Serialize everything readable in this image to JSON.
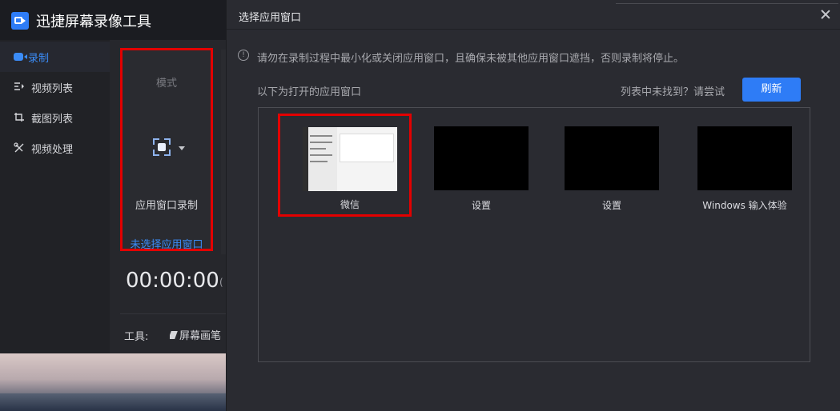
{
  "app": {
    "title": "迅捷屏幕录像工具",
    "logo_icon": "video-camera-icon",
    "accent": "#2e7cf6"
  },
  "sidebar": {
    "items": [
      {
        "label": "录制",
        "icon": "video-camera-icon",
        "active": true
      },
      {
        "label": "视频列表",
        "icon": "video-list-icon",
        "active": false
      },
      {
        "label": "截图列表",
        "icon": "screenshot-list-icon",
        "active": false
      },
      {
        "label": "视频处理",
        "icon": "tools-icon",
        "active": false
      }
    ]
  },
  "main": {
    "mode_label": "模式",
    "mode_icon": "screen-region-icon",
    "mode_name": "应用窗口录制",
    "mode_status": "未选择应用窗口",
    "timer": "00:00:00",
    "timer_extra": "(",
    "tools_label": "工具:",
    "tool_pen_label": "屏幕画笔"
  },
  "dialog": {
    "title": "选择应用窗口",
    "close_icon": "close-icon",
    "warning_icon": "info-circle-icon",
    "warning": "请勿在录制过程中最小化或关闭应用窗口，且确保未被其他应用窗口遮挡，否则录制将停止。",
    "list_heading": "以下为打开的应用窗口",
    "not_found": "列表中未找到？请尝试",
    "refresh_label": "刷新",
    "windows": [
      {
        "label": "微信",
        "selected": true
      },
      {
        "label": "设置",
        "selected": false
      },
      {
        "label": "设置",
        "selected": false
      },
      {
        "label": "Windows 输入体验",
        "selected": false
      }
    ]
  },
  "colors": {
    "highlight": "#e30000",
    "link": "#3b8cf7",
    "button": "#2e7cf6"
  }
}
